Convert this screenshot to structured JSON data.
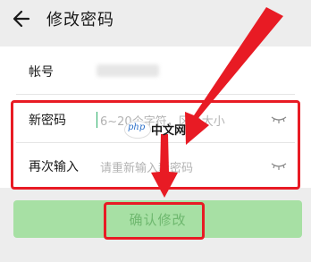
{
  "header": {
    "title": "修改密码",
    "back_icon": "back-arrow-icon"
  },
  "form": {
    "account": {
      "label": "帐号",
      "value_blurred": true
    },
    "new_password": {
      "label": "新密码",
      "placeholder": "6~20个字符，区分大小",
      "visibility_icon": "eye-closed-icon"
    },
    "repeat_password": {
      "label": "再次输入",
      "placeholder": "请重新输入新密码",
      "visibility_icon": "eye-closed-icon"
    }
  },
  "confirm_button": {
    "label": "确认修改",
    "enabled": false
  },
  "watermark": {
    "logo": "php",
    "text": "中文网"
  },
  "colors": {
    "accent": "#2aae67",
    "button_disabled": "#a7e0a4",
    "annotation_red": "#e81b24",
    "background": "#ededed"
  }
}
